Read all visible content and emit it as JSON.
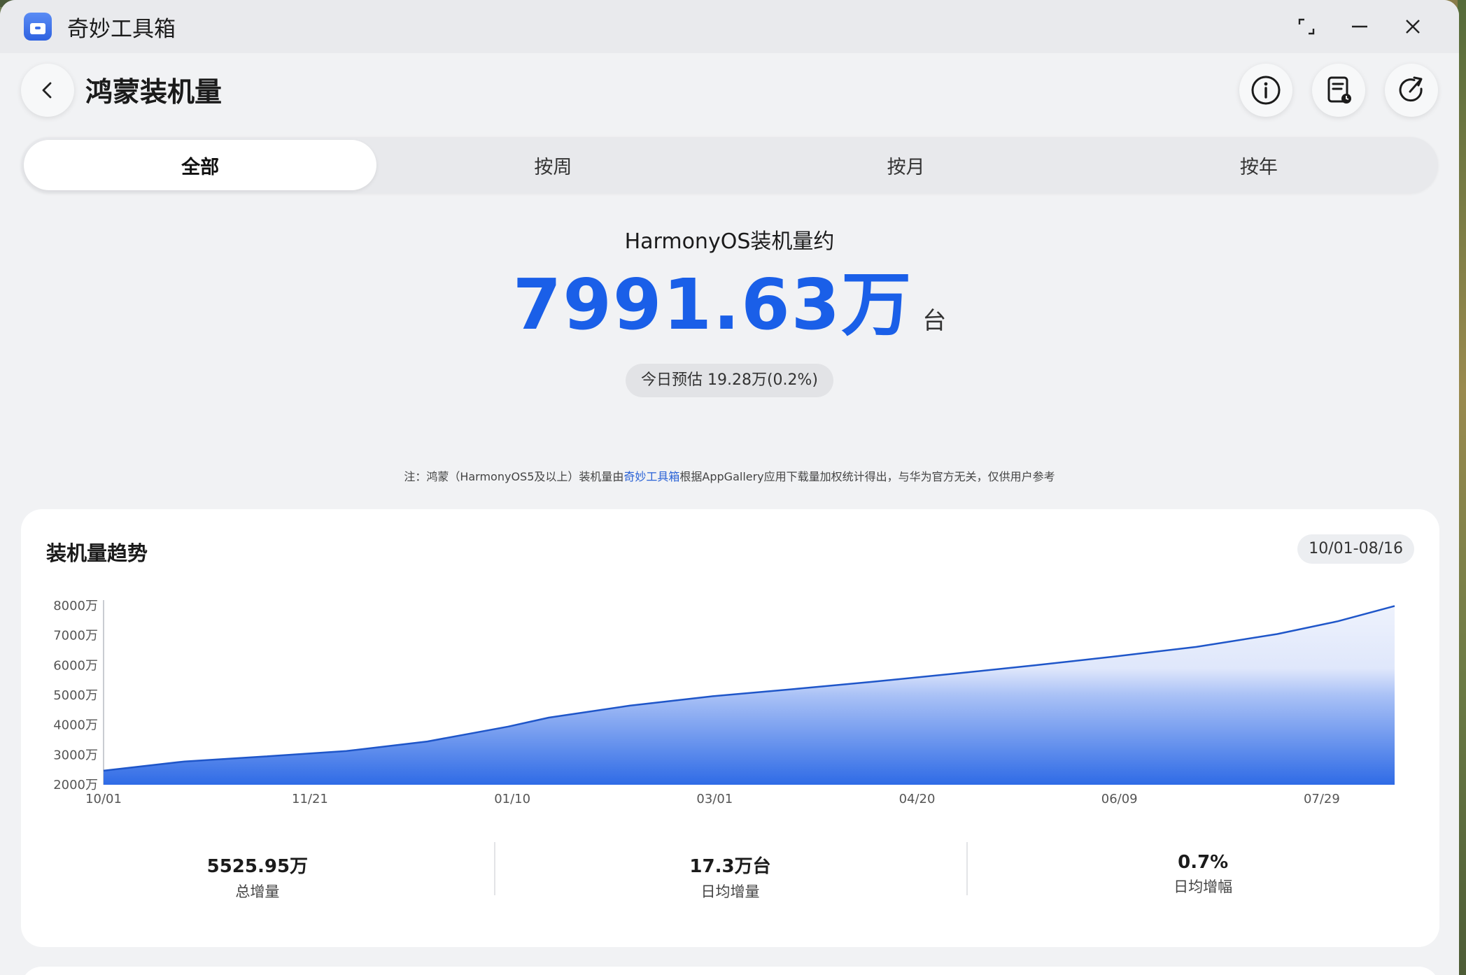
{
  "titlebar": {
    "app_name": "奇妙工具箱"
  },
  "header": {
    "title": "鸿蒙装机量"
  },
  "tabs": [
    {
      "label": "全部",
      "active": true
    },
    {
      "label": "按周",
      "active": false
    },
    {
      "label": "按月",
      "active": false
    },
    {
      "label": "按年",
      "active": false
    }
  ],
  "summary": {
    "label": "HarmonyOS装机量约",
    "value": "7991.63万",
    "unit": "台",
    "today_estimate": "今日预估 19.28万(0.2%)"
  },
  "note": {
    "prefix": "注：鸿蒙（HarmonyOS5及以上）装机量由",
    "link": "奇妙工具箱",
    "suffix": "根据AppGallery应用下载量加权统计得出，与华为官方无关，仅供用户参考"
  },
  "trend": {
    "title": "装机量趋势",
    "date_range": "10/01-08/16",
    "stats": [
      {
        "value": "5525.95万",
        "label": "总增量"
      },
      {
        "value": "17.3万台",
        "label": "日均增量"
      },
      {
        "value": "0.7%",
        "label": "日均增幅"
      }
    ]
  },
  "colors": {
    "accent": "#1a5fe8",
    "area_top": "#e8eefc",
    "area_bottom": "#2f6be6"
  },
  "chart_data": {
    "type": "area",
    "title": "装机量趋势",
    "xlabel": "",
    "ylabel": "",
    "ylim": [
      2000,
      8000
    ],
    "yticks": [
      2000,
      3000,
      4000,
      5000,
      6000,
      7000,
      8000
    ],
    "ytick_labels": [
      "2000万",
      "3000万",
      "4000万",
      "5000万",
      "6000万",
      "7000万",
      "8000万"
    ],
    "xtick_labels": [
      "10/01",
      "11/21",
      "01/10",
      "03/01",
      "04/20",
      "06/09",
      "07/29"
    ],
    "xtick_days": [
      0,
      51,
      101,
      151,
      201,
      251,
      301
    ],
    "x_days": [
      0,
      20,
      40,
      60,
      80,
      100,
      110,
      130,
      150,
      170,
      190,
      210,
      230,
      250,
      270,
      290,
      305,
      319
    ],
    "x_dates": [
      "10/01",
      "10/21",
      "11/10",
      "11/30",
      "12/20",
      "01/09",
      "01/19",
      "02/08",
      "02/28",
      "03/20",
      "04/09",
      "04/29",
      "05/19",
      "06/08",
      "06/28",
      "07/18",
      "08/02",
      "08/16"
    ],
    "values": [
      2470,
      2780,
      2950,
      3130,
      3450,
      3950,
      4250,
      4650,
      4960,
      5200,
      5450,
      5720,
      6000,
      6300,
      6620,
      7050,
      7480,
      7990
    ],
    "grid": false,
    "legend": "none"
  }
}
